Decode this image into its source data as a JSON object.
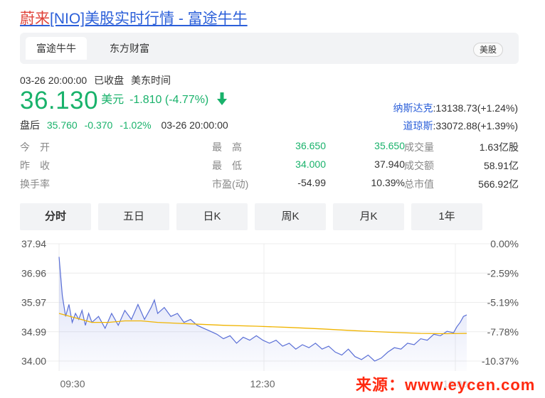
{
  "page": {
    "title_prefix": "蔚来",
    "title_rest": "[NIO]美股实时行情 - 富途牛牛"
  },
  "tabs": {
    "active": "富途牛牛",
    "second": "东方财富",
    "market": "美股"
  },
  "quote": {
    "date": "03-26 20:00:00",
    "status": "已收盘",
    "timezone": "美东时间",
    "price": "36.130",
    "currency": "美元",
    "change": "-1.810 (-4.77%)",
    "after_label": "盘后",
    "after_price": "35.760",
    "after_change": "-0.370",
    "after_pct": "-1.02%",
    "after_time": "03-26 20:00:00"
  },
  "indices": [
    {
      "name": "纳斯达克",
      "value": ":13138.73(+1.24%)"
    },
    {
      "name": "道琼斯",
      "value": ":33072.88(+1.39%)"
    }
  ],
  "stats": [
    [
      {
        "label": "今　开",
        "value": "35.650",
        "color": "green"
      },
      {
        "label": "最　高",
        "value": "36.650",
        "color": "green"
      },
      {
        "label": "成交量",
        "value": "1.63亿股",
        "color": "normal"
      }
    ],
    [
      {
        "label": "昨　收",
        "value": "37.940",
        "color": "normal"
      },
      {
        "label": "最　低",
        "value": "34.000",
        "color": "green"
      },
      {
        "label": "成交额",
        "value": "58.91亿",
        "color": "normal"
      }
    ],
    [
      {
        "label": "换手率",
        "value": "10.39%",
        "color": "normal"
      },
      {
        "label": "市盈(动)",
        "value": "-54.99",
        "color": "normal"
      },
      {
        "label": "总市值",
        "value": "566.92亿",
        "color": "normal"
      }
    ]
  ],
  "periods": [
    "分时",
    "五日",
    "日K",
    "周K",
    "月K",
    "1年"
  ],
  "chart_data": {
    "type": "line",
    "ylim": [
      34.0,
      37.94
    ],
    "yticks": [
      "37.94",
      "36.96",
      "35.97",
      "34.99",
      "34.00"
    ],
    "pct_ticks": [
      "0.00%",
      "-2.59%",
      "-5.19%",
      "-7.78%",
      "-10.37%"
    ],
    "xticks": [
      "09:30",
      "12:30",
      "16:00"
    ],
    "series": [
      {
        "color": "#5a6fd6",
        "points": [
          [
            0,
            37.5
          ],
          [
            1,
            36.2
          ],
          [
            2,
            35.5
          ],
          [
            3,
            35.9
          ],
          [
            4,
            35.3
          ],
          [
            5,
            35.6
          ],
          [
            6,
            35.4
          ],
          [
            7,
            35.7
          ],
          [
            8,
            35.2
          ],
          [
            9,
            35.6
          ],
          [
            10,
            35.3
          ],
          [
            12,
            35.5
          ],
          [
            14,
            35.1
          ],
          [
            16,
            35.6
          ],
          [
            18,
            35.2
          ],
          [
            20,
            35.7
          ],
          [
            22,
            35.4
          ],
          [
            24,
            35.9
          ],
          [
            26,
            35.4
          ],
          [
            28,
            35.8
          ],
          [
            29,
            36.05
          ],
          [
            30,
            35.6
          ],
          [
            32,
            35.8
          ],
          [
            34,
            35.5
          ],
          [
            36,
            35.6
          ],
          [
            38,
            35.3
          ],
          [
            40,
            35.4
          ],
          [
            42,
            35.2
          ],
          [
            44,
            35.1
          ],
          [
            46,
            35.0
          ],
          [
            48,
            34.9
          ],
          [
            50,
            34.75
          ],
          [
            52,
            34.85
          ],
          [
            54,
            34.6
          ],
          [
            56,
            34.8
          ],
          [
            58,
            34.7
          ],
          [
            60,
            34.85
          ],
          [
            62,
            34.7
          ],
          [
            64,
            34.6
          ],
          [
            66,
            34.7
          ],
          [
            68,
            34.5
          ],
          [
            70,
            34.6
          ],
          [
            72,
            34.4
          ],
          [
            74,
            34.55
          ],
          [
            76,
            34.45
          ],
          [
            78,
            34.6
          ],
          [
            80,
            34.4
          ],
          [
            82,
            34.5
          ],
          [
            84,
            34.3
          ],
          [
            86,
            34.2
          ],
          [
            88,
            34.4
          ],
          [
            90,
            34.15
          ],
          [
            92,
            34.05
          ],
          [
            94,
            34.2
          ],
          [
            96,
            34.0
          ],
          [
            98,
            34.1
          ],
          [
            100,
            34.3
          ],
          [
            102,
            34.45
          ],
          [
            104,
            34.4
          ],
          [
            106,
            34.6
          ],
          [
            108,
            34.55
          ],
          [
            110,
            34.75
          ],
          [
            112,
            34.7
          ],
          [
            114,
            34.9
          ],
          [
            116,
            34.85
          ],
          [
            118,
            35.0
          ],
          [
            120,
            34.95
          ],
          [
            121,
            35.15
          ],
          [
            122,
            35.3
          ],
          [
            123,
            35.5
          ],
          [
            124,
            35.55
          ]
        ]
      },
      {
        "color": "#f0b400",
        "points": [
          [
            0,
            35.6
          ],
          [
            5,
            35.45
          ],
          [
            10,
            35.3
          ],
          [
            15,
            35.3
          ],
          [
            20,
            35.35
          ],
          [
            25,
            35.35
          ],
          [
            30,
            35.3
          ],
          [
            40,
            35.25
          ],
          [
            50,
            35.2
          ],
          [
            60,
            35.17
          ],
          [
            70,
            35.13
          ],
          [
            80,
            35.08
          ],
          [
            90,
            35.02
          ],
          [
            100,
            34.97
          ],
          [
            110,
            34.93
          ],
          [
            118,
            34.92
          ],
          [
            124,
            34.93
          ]
        ]
      }
    ]
  },
  "watermark": "来源：www.eycen.com"
}
